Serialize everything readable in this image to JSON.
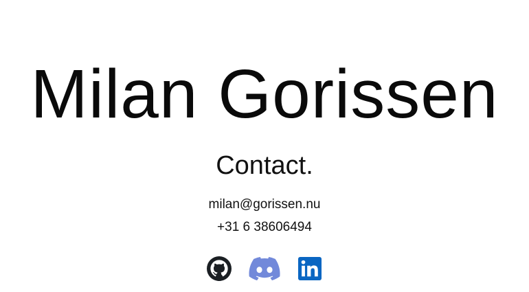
{
  "profile": {
    "name": "Milan Gorissen"
  },
  "contact": {
    "title": "Contact.",
    "email": "milan@gorissen.nu",
    "phone": "+31 6 38606494"
  },
  "socials": [
    {
      "icon": "github-icon",
      "label": "GitHub",
      "color": "#1b1f23"
    },
    {
      "icon": "discord-icon",
      "label": "Discord",
      "color": "#7289da"
    },
    {
      "icon": "linkedin-icon",
      "label": "LinkedIn",
      "color": "#0a66c2"
    }
  ]
}
